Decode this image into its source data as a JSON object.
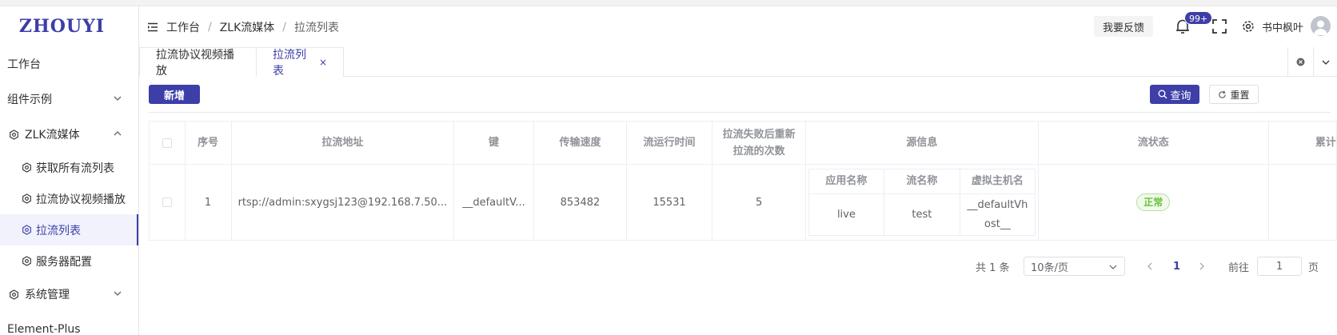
{
  "app": {
    "logo": "ZHOUYI"
  },
  "sidebar": {
    "items": [
      {
        "label": "工作台"
      },
      {
        "label": "组件示例"
      },
      {
        "label": "ZLK流媒体"
      },
      {
        "label": "系统管理"
      },
      {
        "label": "Element-Plus"
      }
    ],
    "subitems": [
      {
        "label": "获取所有流列表"
      },
      {
        "label": "拉流协议视频播放"
      },
      {
        "label": "拉流列表"
      },
      {
        "label": "服务器配置"
      }
    ]
  },
  "header": {
    "breadcrumb": [
      "工作台",
      "ZLK流媒体",
      "拉流列表"
    ],
    "breadcrumb_sep": "/",
    "feedback": "我要反馈",
    "badge": "99+",
    "username": "书中枫叶"
  },
  "tabs": [
    {
      "label": "拉流协议视频播放"
    },
    {
      "label": "拉流列表",
      "close": "×"
    }
  ],
  "toolbar": {
    "add": "新增",
    "query": "查询",
    "reset": "重置"
  },
  "table": {
    "headers": {
      "index": "序号",
      "url": "拉流地址",
      "key": "键",
      "speed": "传输速度",
      "runtime": "流运行时间",
      "retry": "拉流失败后重新拉流的次数",
      "source": "源信息",
      "status": "流状态",
      "cumulative": "累计"
    },
    "source_headers": {
      "app": "应用名称",
      "stream": "流名称",
      "vhost": "虚拟主机名"
    },
    "rows": [
      {
        "index": "1",
        "url": "rtsp://admin:sxygsj123@192.168.7.50...",
        "key": "__defaultV...",
        "speed": "853482",
        "runtime": "15531",
        "retry": "5",
        "app": "live",
        "stream": "test",
        "vhost": "__defaultVhost__",
        "status": "正常"
      }
    ]
  },
  "pagination": {
    "total": "共 1 条",
    "page_size": "10条/页",
    "current_page": "1",
    "goto_label": "前往",
    "goto_value": "1",
    "goto_suffix": "页"
  },
  "colors": {
    "primary": "#3d3ea8",
    "success": "#67c23a",
    "border": "#ebeef5"
  }
}
